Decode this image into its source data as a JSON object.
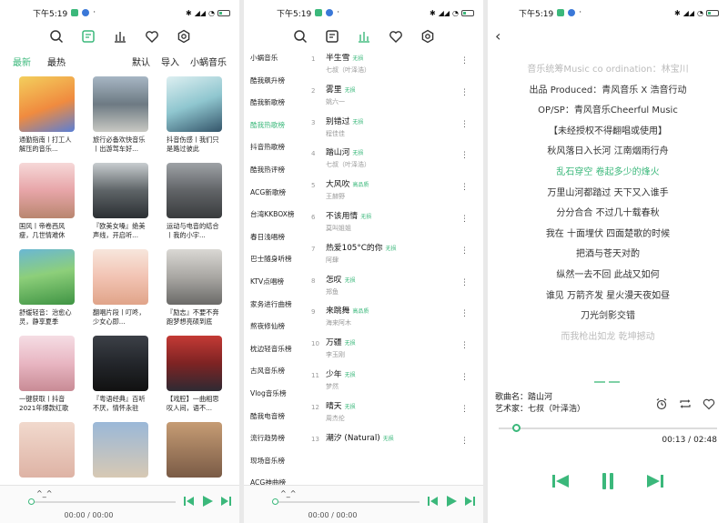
{
  "status": {
    "time": "下午5:19",
    "battery": "88"
  },
  "colors": {
    "accent": "#3bb87b"
  },
  "toolbar_icons": [
    "search-icon",
    "playlist-icon",
    "chart-icon",
    "heart-icon",
    "settings-icon"
  ],
  "screen1": {
    "tabs": [
      "最新",
      "最热"
    ],
    "actions": [
      "默认",
      "导入",
      "小蜗音乐"
    ],
    "playlists": [
      {
        "title": "通勤指南丨打工人解压的音乐..."
      },
      {
        "title": "旅行必备欢快音乐丨出游驾车好..."
      },
      {
        "title": "抖音伤感丨我们只是路过彼此"
      },
      {
        "title": "国风丨帝卷西风瘦，几世情难休"
      },
      {
        "title": "『欧美女嗓』绝美声线，开启听..."
      },
      {
        "title": "运动与电音的结合丨我的小宇..."
      },
      {
        "title": "舒缓轻音：治愈心灵，静享夏季"
      },
      {
        "title": "翻唱片段丨叮咚，少女心即..."
      },
      {
        "title": "『励志』不要不奔跑梦想亮硕到底"
      },
      {
        "title": "一键获取丨抖音2021年爆款红歌"
      },
      {
        "title": "『粤语经典』百听不厌，情怀永驻"
      },
      {
        "title": "【戏腔】一曲相思叹人间，语不..."
      },
      {
        "title": ""
      },
      {
        "title": ""
      },
      {
        "title": ""
      }
    ],
    "player": {
      "title": "^_^",
      "time": "00:00 / 00:00"
    }
  },
  "screen2": {
    "ranks": [
      "小蜗音乐",
      "酷我飙升榜",
      "酷我新歌榜",
      "酷我热歌榜",
      "抖音热歌榜",
      "酷我热评榜",
      "ACG新歌榜",
      "台湾KKBOX榜",
      "春日浅唱榜",
      "巴士随身听榜",
      "KTV点唱榜",
      "家务进行曲榜",
      "熬夜修仙榜",
      "枕边轻音乐榜",
      "古风音乐榜",
      "Vlog音乐榜",
      "酷我电音榜",
      "流行趋势榜",
      "现场音乐榜",
      "ACG神曲榜"
    ],
    "active_rank": 3,
    "songs": [
      {
        "num": "1",
        "name": "半生雪",
        "tag": "无损",
        "artist": "七叔（叶泽浩）"
      },
      {
        "num": "2",
        "name": "雾里",
        "tag": "无损",
        "artist": "姚六一"
      },
      {
        "num": "3",
        "name": "别错过",
        "tag": "无损",
        "artist": "程佳佳"
      },
      {
        "num": "4",
        "name": "踏山河",
        "tag": "无损",
        "artist": "七叔（叶泽浩）"
      },
      {
        "num": "5",
        "name": "大风吹",
        "tag": "高品质",
        "artist": "王赫野"
      },
      {
        "num": "6",
        "name": "不该用情",
        "tag": "无损",
        "artist": "莫叫姐姐"
      },
      {
        "num": "7",
        "name": "热爱105°C的你",
        "tag": "无损",
        "artist": "阿肆"
      },
      {
        "num": "8",
        "name": "怎叹",
        "tag": "无损",
        "artist": "郑鱼"
      },
      {
        "num": "9",
        "name": "来跳舞",
        "tag": "高品质",
        "artist": "海来阿木"
      },
      {
        "num": "10",
        "name": "万疆",
        "tag": "无损",
        "artist": "李玉刚"
      },
      {
        "num": "11",
        "name": "少年",
        "tag": "无损",
        "artist": "梦然"
      },
      {
        "num": "12",
        "name": "晴天",
        "tag": "无损",
        "artist": "周杰伦"
      },
      {
        "num": "13",
        "name": "潮汐 (Natural)",
        "tag": "无损",
        "artist": ""
      }
    ],
    "player": {
      "title": "^_^",
      "time": "00:00 / 00:00"
    }
  },
  "screen3": {
    "lyrics": [
      "音乐统筹Music co ordination：林宝川",
      "出品 Produced：青风音乐 X 浩音行动",
      "OP/SP：青风音乐Cheerful Music",
      "【未经授权不得翻唱或使用】",
      "秋风落日入长河 江南烟雨行舟",
      "乱石穿空 卷起多少的烽火",
      "万里山河都踏过 天下又入谁手",
      "分分合合 不过几十载春秋",
      "我在 十面埋伏 四面楚歌的时候",
      "把酒与苍天对酌",
      "纵然一去不回 此战又如何",
      "谁见 万箭齐发 星火漫天夜如昼",
      "刀光剑影交错",
      "而我枪出如龙 乾坤撼动"
    ],
    "current_lyric": 5,
    "song_label": "歌曲名：踏山河",
    "artist_label": "艺术家：七叔（叶泽浩）",
    "elapsed": "00:13",
    "separator": " / ",
    "total": "02:48",
    "progress": 0.08
  }
}
